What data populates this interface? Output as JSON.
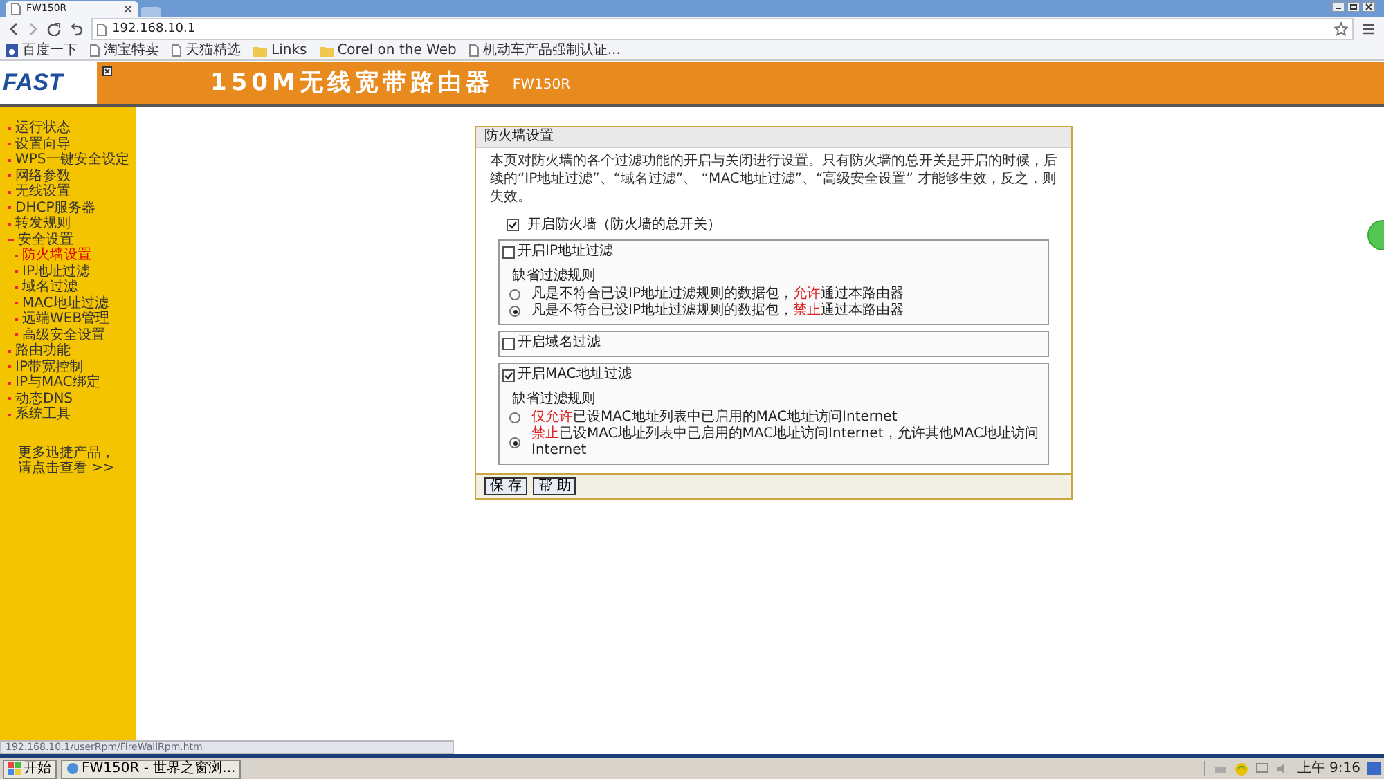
{
  "browser": {
    "tab_title": "FW150R",
    "url": "192.168.10.1",
    "bookmarks": [
      {
        "label": "百度一下",
        "kind": "site"
      },
      {
        "label": "淘宝特卖",
        "kind": "page"
      },
      {
        "label": "天猫精选",
        "kind": "page"
      },
      {
        "label": "Links",
        "kind": "folder"
      },
      {
        "label": "Corel on the Web",
        "kind": "folder"
      },
      {
        "label": "机动车产品强制认证...",
        "kind": "page"
      }
    ]
  },
  "header": {
    "logo": "FAST",
    "title": "150M无线宽带路由器",
    "model": "FW150R"
  },
  "sidebar": {
    "items": [
      {
        "label": "运行状态",
        "selected": false
      },
      {
        "label": "设置向导",
        "selected": false
      },
      {
        "label": "WPS一键安全设定",
        "selected": false
      },
      {
        "label": "网络参数",
        "selected": false
      },
      {
        "label": "无线设置",
        "selected": false
      },
      {
        "label": "DHCP服务器",
        "selected": false
      },
      {
        "label": "转发规则",
        "selected": false
      },
      {
        "label": "安全设置",
        "selected": false,
        "expanded": true,
        "children": [
          {
            "label": "防火墙设置",
            "selected": true
          },
          {
            "label": "IP地址过滤",
            "selected": false
          },
          {
            "label": "域名过滤",
            "selected": false
          },
          {
            "label": "MAC地址过滤",
            "selected": false
          },
          {
            "label": "远端WEB管理",
            "selected": false
          },
          {
            "label": "高级安全设置",
            "selected": false
          }
        ]
      },
      {
        "label": "路由功能",
        "selected": false
      },
      {
        "label": "IP带宽控制",
        "selected": false
      },
      {
        "label": "IP与MAC绑定",
        "selected": false
      },
      {
        "label": "动态DNS",
        "selected": false
      },
      {
        "label": "系统工具",
        "selected": false
      }
    ],
    "promo": [
      "更多迅捷产品，",
      "请点击查看 >>"
    ]
  },
  "panel": {
    "title": "防火墙设置",
    "description": "本页对防火墙的各个过滤功能的开启与关闭进行设置。只有防火墙的总开关是开启的时候，后续的“IP地址过滤”、“域名过滤”、 “MAC地址过滤”、“高级安全设置” 才能够生效，反之，则失效。",
    "master_switch": {
      "label": "开启防火墙（防火墙的总开关）",
      "checked": true
    },
    "sections": [
      {
        "label": "开启IP地址过滤",
        "checked": false,
        "rule_title": "缺省过滤规则",
        "options": [
          {
            "text": "凡是不符合已设IP地址过滤规则的数据包，**允许**通过本路由器",
            "selected": false
          },
          {
            "text": "凡是不符合已设IP地址过滤规则的数据包，**禁止**通过本路由器",
            "selected": true
          }
        ]
      },
      {
        "label": "开启域名过滤",
        "checked": false
      },
      {
        "label": "开启MAC地址过滤",
        "checked": true,
        "rule_title": "缺省过滤规则",
        "options": [
          {
            "text": "**仅允许**已设MAC地址列表中已启用的MAC地址访问Internet",
            "selected": false
          },
          {
            "text": "**禁止**已设MAC地址列表中已启用的MAC地址访问Internet，允许其他MAC地址访问Internet",
            "selected": true
          }
        ]
      }
    ],
    "buttons": [
      "保 存",
      "帮 助"
    ]
  },
  "status_url": "192.168.10.1/userRpm/FireWallRpm.htm",
  "taskbar": {
    "start": "开始",
    "task": "FW150R - 世界之窗浏...",
    "clock": "上午 9:16"
  }
}
